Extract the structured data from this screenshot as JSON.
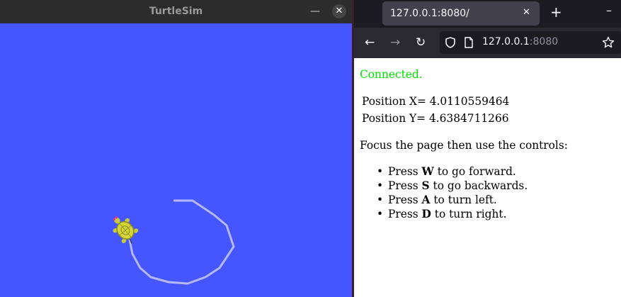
{
  "turtlesim": {
    "title": "TurtleSim",
    "minimize_glyph": "—",
    "close_glyph": "✕",
    "background_color": "#4656ff",
    "trail_color": "#b3b8ff",
    "turtle_color": "#d3d53a"
  },
  "browser": {
    "tab": {
      "title": "127.0.0.1:8080/",
      "close_glyph": "✕"
    },
    "new_tab_glyph": "+",
    "window_minimize_glyph": "–",
    "nav": {
      "back_glyph": "←",
      "forward_glyph": "→",
      "reload_glyph": "↻"
    },
    "url": {
      "host": "127.0.0.1",
      "port": ":8080"
    },
    "page": {
      "status": "Connected.",
      "position_x": "Position X= 4.0110559464",
      "position_y": "Position Y= 4.6384711266",
      "instructions": "Focus the page then use the controls:",
      "controls": [
        {
          "prefix": "Press ",
          "key": "W",
          "suffix": " to go forward."
        },
        {
          "prefix": "Press ",
          "key": "S",
          "suffix": " to go backwards."
        },
        {
          "prefix": "Press ",
          "key": "A",
          "suffix": " to turn left."
        },
        {
          "prefix": "Press ",
          "key": "D",
          "suffix": " to turn right."
        }
      ]
    }
  }
}
